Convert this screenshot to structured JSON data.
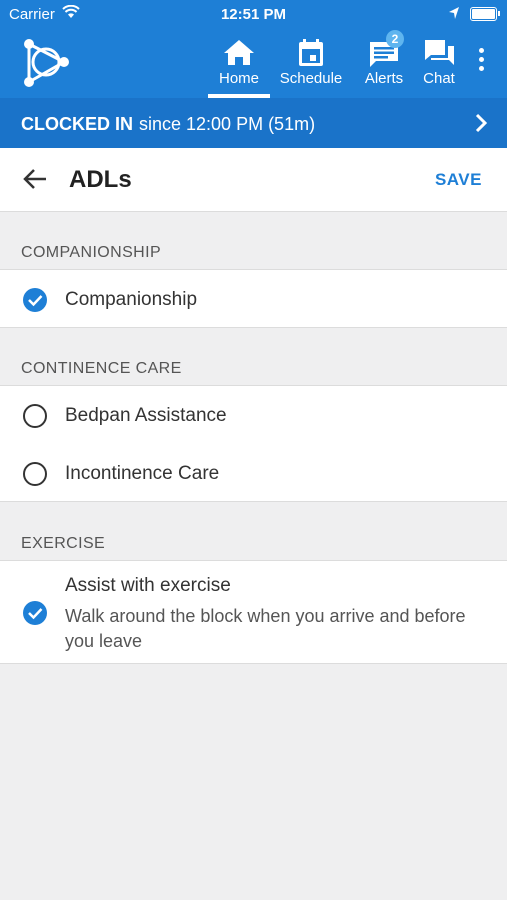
{
  "status_bar": {
    "carrier": "Carrier",
    "time": "12:51 PM"
  },
  "nav": {
    "items": [
      {
        "label": "Home",
        "icon": "home-icon"
      },
      {
        "label": "Schedule",
        "icon": "calendar-icon"
      },
      {
        "label": "Alerts",
        "icon": "alerts-icon",
        "badge": "2"
      },
      {
        "label": "Chat",
        "icon": "chat-icon"
      }
    ],
    "active": "Home"
  },
  "clock": {
    "status": "CLOCKED IN",
    "since": "since 12:00 PM (51m)"
  },
  "header": {
    "title": "ADLs",
    "save_label": "SAVE"
  },
  "sections": [
    {
      "title": "COMPANIONSHIP",
      "items": [
        {
          "label": "Companionship",
          "checked": true
        }
      ]
    },
    {
      "title": "CONTINENCE CARE",
      "items": [
        {
          "label": "Bedpan Assistance",
          "checked": false
        },
        {
          "label": "Incontinence Care",
          "checked": false
        }
      ]
    },
    {
      "title": "EXERCISE",
      "items": [
        {
          "label": "Assist with exercise",
          "description": "Walk around the block when you arrive and before you leave",
          "checked": true
        }
      ]
    }
  ],
  "colors": {
    "brand": "#1e7fd6",
    "clock_bar": "#1a73c9",
    "background": "#efeff0"
  }
}
